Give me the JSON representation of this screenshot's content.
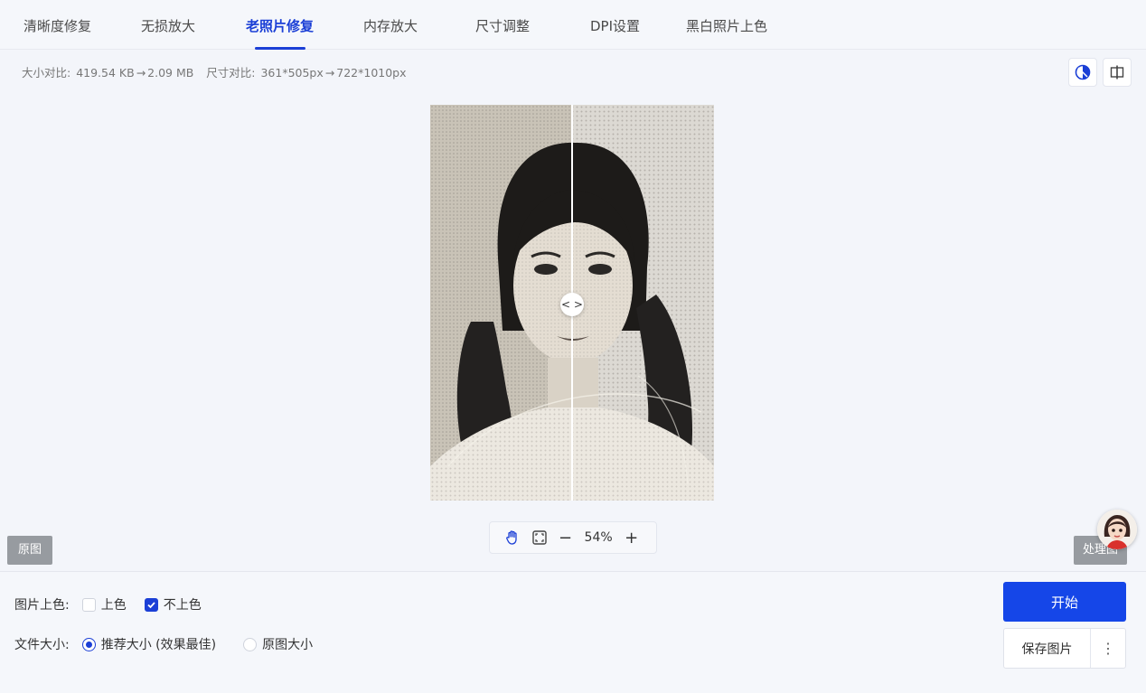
{
  "tabs": [
    {
      "label": "清晰度修复",
      "active": false
    },
    {
      "label": "无损放大",
      "active": false
    },
    {
      "label": "老照片修复",
      "active": true
    },
    {
      "label": "内存放大",
      "active": false
    },
    {
      "label": "尺寸调整",
      "active": false
    },
    {
      "label": "DPI设置",
      "active": false
    },
    {
      "label": "黑白照片上色",
      "active": false
    }
  ],
  "info": {
    "size_label": "大小对比:",
    "size_before": "419.54 KB",
    "size_after": "2.09 MB",
    "dim_label": "尺寸对比:",
    "dim_before": "361*505px",
    "dim_after": "722*1010px",
    "arrow": "→"
  },
  "tools": {
    "contrast_icon": "half-circle-contrast-icon",
    "split_icon": "split-compare-icon"
  },
  "preview": {
    "divider_glyph": "< >",
    "original_label": "原图",
    "processed_label": "处理图"
  },
  "zoom": {
    "value": "54%",
    "minus": "−",
    "plus": "+"
  },
  "colorize": {
    "label": "图片上色:",
    "options": [
      {
        "label": "上色",
        "checked": false
      },
      {
        "label": "不上色",
        "checked": true
      }
    ]
  },
  "filesize": {
    "label": "文件大小:",
    "options": [
      {
        "label": "推荐大小 (效果最佳)",
        "selected": true
      },
      {
        "label": "原图大小",
        "selected": false
      }
    ]
  },
  "actions": {
    "start_label": "开始",
    "save_label": "保存图片",
    "more_label": "⋮"
  },
  "colors": {
    "accent": "#1b3fd6",
    "primary_button": "#1546e8"
  }
}
